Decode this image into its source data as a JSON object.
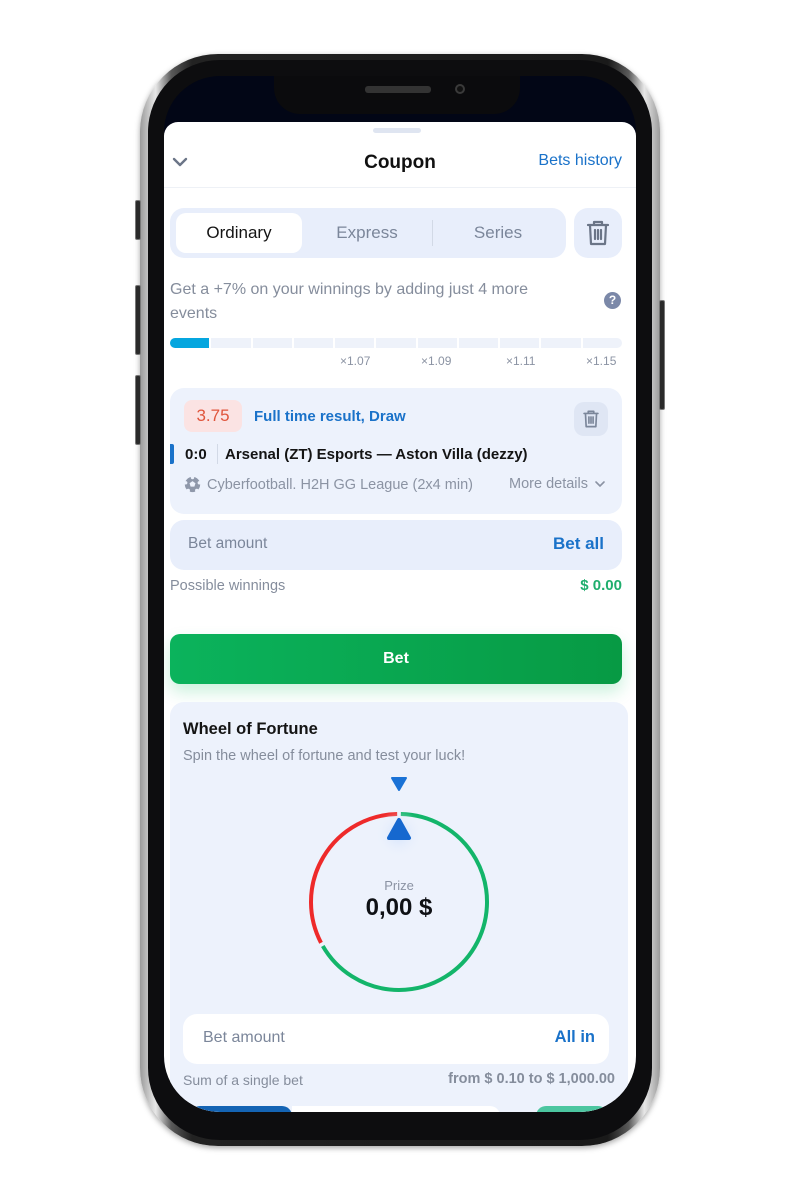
{
  "header": {
    "title": "Coupon",
    "bets_history": "Bets history"
  },
  "tabs": [
    {
      "label": "Ordinary",
      "active": true
    },
    {
      "label": "Express",
      "active": false
    },
    {
      "label": "Series",
      "active": false
    }
  ],
  "promo": {
    "text": "Get a +7% on your winnings by adding just 4 more events",
    "help_glyph": "?",
    "progress": {
      "segments_total": 11,
      "segments_filled": 1,
      "labels": [
        "×1.07",
        "×1.09",
        "×1.11",
        "×1.15"
      ]
    }
  },
  "event": {
    "odds": "3.75",
    "market": "Full time result, Draw",
    "score": "0:0",
    "teams": "Arsenal (ZT) Esports — Aston Villa (dezzy)",
    "league": "Cyberfootball. H2H GG League (2x4 min)",
    "more_details": "More details"
  },
  "bet": {
    "amount_placeholder": "Bet amount",
    "bet_all": "Bet all",
    "possible_winnings_label": "Possible winnings",
    "possible_winnings_value": "$ 0.00",
    "bet_button": "Bet"
  },
  "wheel": {
    "title": "Wheel of Fortune",
    "subtitle": "Spin the wheel of fortune and test your luck!",
    "prize_label": "Prize",
    "prize_value": "0,00 $",
    "red_fraction": 0.33,
    "green_fraction": 0.67,
    "amount_placeholder": "Bet amount",
    "all_in": "All in",
    "sum_label": "Sum of a single bet",
    "sum_range": "from $ 0.10 to $ 1,000.00"
  },
  "colors": {
    "accent_blue": "#1a72c9",
    "bet_green": "#0bb35c",
    "odds_red": "#e0553c",
    "wheel_red": "#ee2a2a",
    "wheel_green": "#13b56a",
    "progress_blue": "#05a6df"
  }
}
